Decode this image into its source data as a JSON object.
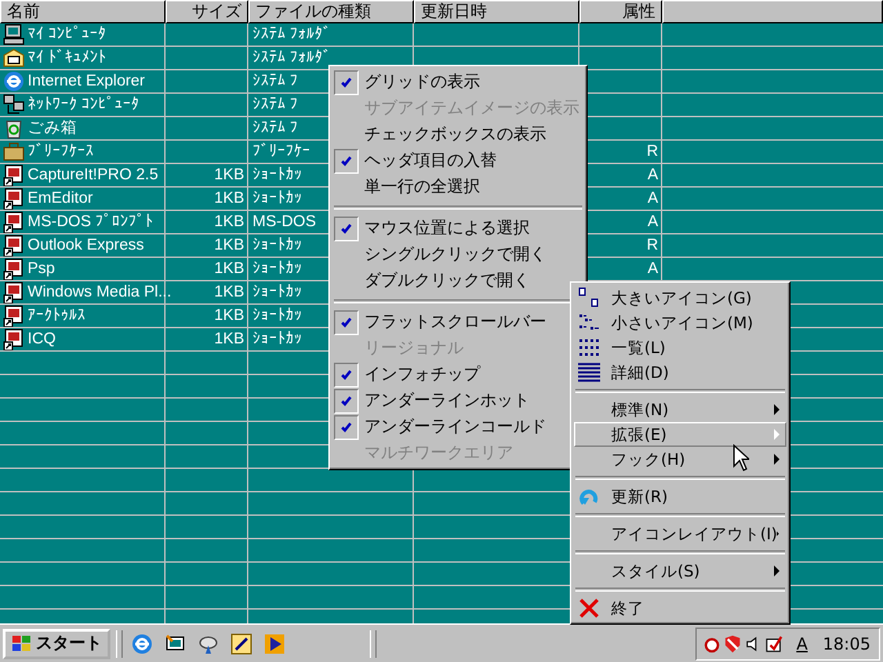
{
  "list": {
    "columns": [
      "名前",
      "サイズ",
      "ファイルの種類",
      "更新日時",
      "属性"
    ],
    "rows": [
      {
        "kind": "computer",
        "name": "ﾏｲ ｺﾝﾋﾟｭｰﾀ",
        "size": "",
        "type": "ｼｽﾃﾑ ﾌｫﾙﾀﾞ",
        "attr": ""
      },
      {
        "kind": "folder",
        "name": "ﾏｲ ﾄﾞｷｭﾒﾝﾄ",
        "size": "",
        "type": "ｼｽﾃﾑ ﾌｫﾙﾀﾞ",
        "attr": ""
      },
      {
        "kind": "globe",
        "name": "Internet Explorer",
        "size": "",
        "type": "ｼｽﾃﾑ ﾌ",
        "attr": ""
      },
      {
        "kind": "network",
        "name": "ﾈｯﾄﾜｰｸ ｺﾝﾋﾟｭｰﾀ",
        "size": "",
        "type": "ｼｽﾃﾑ ﾌ",
        "attr": ""
      },
      {
        "kind": "trash",
        "name": "ごみ箱",
        "size": "",
        "type": "ｼｽﾃﾑ ﾌ",
        "attr": ""
      },
      {
        "kind": "briefcase",
        "name": "ﾌﾞﾘｰﾌｹｰｽ",
        "size": "",
        "type": "ﾌﾞﾘｰﾌｹｰ",
        "attr": "R"
      },
      {
        "kind": "app",
        "name": "CaptureIt!PRO 2.5",
        "size": "1KB",
        "type": "ｼｮｰﾄｶｯ",
        "attr": "A"
      },
      {
        "kind": "app",
        "name": "EmEditor",
        "size": "1KB",
        "type": "ｼｮｰﾄｶｯ",
        "attr": "A"
      },
      {
        "kind": "app",
        "name": "MS-DOS ﾌﾟﾛﾝﾌﾟﾄ",
        "size": "1KB",
        "type": "MS-DOS",
        "attr": "A"
      },
      {
        "kind": "app",
        "name": "Outlook Express",
        "size": "1KB",
        "type": "ｼｮｰﾄｶｯ",
        "attr": "R"
      },
      {
        "kind": "app",
        "name": "Psp",
        "size": "1KB",
        "type": "ｼｮｰﾄｶｯ",
        "attr": "A"
      },
      {
        "kind": "app",
        "name": "Windows Media Pl...",
        "size": "1KB",
        "type": "ｼｮｰﾄｶｯ",
        "attr": ""
      },
      {
        "kind": "app",
        "name": "ｱｰｸﾄｩﾙｽ",
        "size": "1KB",
        "type": "ｼｮｰﾄｶｯ",
        "attr": ""
      },
      {
        "kind": "app",
        "name": "ICQ",
        "size": "1KB",
        "type": "ｼｮｰﾄｶｯ",
        "attr": ""
      }
    ]
  },
  "options_menu": [
    {
      "kind": "item",
      "label": "グリッドの表示",
      "checked": true,
      "disabled": false
    },
    {
      "kind": "item",
      "label": "サブアイテムイメージの表示",
      "checked": false,
      "disabled": true
    },
    {
      "kind": "item",
      "label": "チェックボックスの表示",
      "checked": false,
      "disabled": false
    },
    {
      "kind": "item",
      "label": "ヘッダ項目の入替",
      "checked": true,
      "disabled": false
    },
    {
      "kind": "item",
      "label": "単一行の全選択",
      "checked": false,
      "disabled": false
    },
    {
      "kind": "separator"
    },
    {
      "kind": "item",
      "label": "マウス位置による選択",
      "checked": true,
      "disabled": false
    },
    {
      "kind": "item",
      "label": "シングルクリックで開く",
      "checked": false,
      "disabled": false
    },
    {
      "kind": "item",
      "label": "ダブルクリックで開く",
      "checked": false,
      "disabled": false
    },
    {
      "kind": "separator"
    },
    {
      "kind": "item",
      "label": "フラットスクロールバー",
      "checked": true,
      "disabled": false
    },
    {
      "kind": "item",
      "label": "リージョナル",
      "checked": false,
      "disabled": true
    },
    {
      "kind": "item",
      "label": "インフォチップ",
      "checked": true,
      "disabled": false
    },
    {
      "kind": "item",
      "label": "アンダーラインホット",
      "checked": true,
      "disabled": false
    },
    {
      "kind": "item",
      "label": "アンダーラインコールド",
      "checked": true,
      "disabled": false
    },
    {
      "kind": "item",
      "label": "マルチワークエリア",
      "checked": false,
      "disabled": true
    }
  ],
  "context_menu": [
    {
      "kind": "large-icons",
      "label": "大きいアイコン(G)",
      "submenu": false,
      "selected": false
    },
    {
      "kind": "small-icons",
      "label": "小さいアイコン(M)",
      "submenu": false,
      "selected": false
    },
    {
      "kind": "list",
      "label": "一覧(L)",
      "submenu": false,
      "selected": false
    },
    {
      "kind": "details",
      "label": "詳細(D)",
      "submenu": false,
      "selected": false
    },
    {
      "kind": "separator"
    },
    {
      "kind": "plain",
      "label": "標準(N)",
      "submenu": true,
      "selected": false
    },
    {
      "kind": "plain",
      "label": "拡張(E)",
      "submenu": true,
      "selected": true
    },
    {
      "kind": "plain",
      "label": "フック(H)",
      "submenu": true,
      "selected": false
    },
    {
      "kind": "separator"
    },
    {
      "kind": "refresh",
      "label": "更新(R)",
      "submenu": false,
      "selected": false
    },
    {
      "kind": "separator"
    },
    {
      "kind": "plain",
      "label": "アイコンレイアウト(I)",
      "submenu": true,
      "selected": false
    },
    {
      "kind": "separator"
    },
    {
      "kind": "plain",
      "label": "スタイル(S)",
      "submenu": true,
      "selected": false
    },
    {
      "kind": "separator"
    },
    {
      "kind": "exit",
      "label": "終了",
      "submenu": false,
      "selected": false
    }
  ],
  "taskbar": {
    "start": "スタート",
    "ime": "A",
    "clock": "18:05"
  }
}
